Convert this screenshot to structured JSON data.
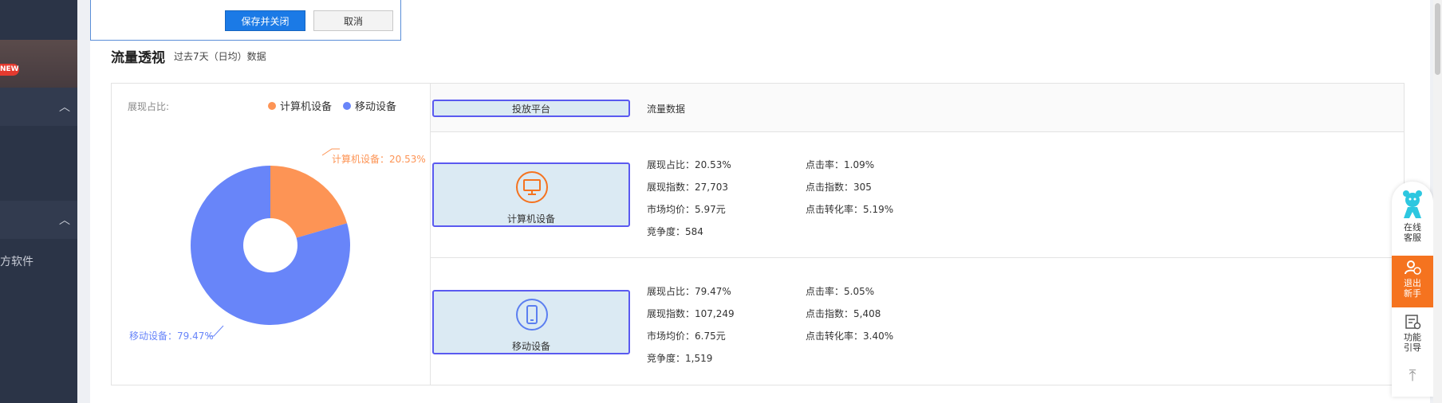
{
  "dialog": {
    "save_label": "保存并关闭",
    "cancel_label": "取消"
  },
  "sidebar": {
    "new_badge": "NEW",
    "item_label": "方软件"
  },
  "header": {
    "title": "流量透视",
    "subtitle": "过去7天（日均）数据"
  },
  "chart_data": {
    "type": "pie",
    "title": "展现占比:",
    "categories": [
      "计算机设备",
      "移动设备"
    ],
    "values": [
      20.53,
      79.47
    ],
    "colors": [
      "#fd9455",
      "#6885f9"
    ],
    "labels": [
      "计算机设备：20.53%",
      "移动设备：79.47%"
    ],
    "legend_position": "top-right",
    "donut": true
  },
  "table": {
    "col_platform": "投放平台",
    "col_data": "流量数据",
    "rows": [
      {
        "device": "计算机设备",
        "icon": "monitor-icon",
        "color": "#f5731f",
        "left": [
          "展现占比：20.53%",
          "展现指数：27,703",
          "市场均价：5.97元",
          "竞争度：584"
        ],
        "right": [
          "点击率：1.09%",
          "点击指数：305",
          "点击转化率：5.19%"
        ]
      },
      {
        "device": "移动设备",
        "icon": "phone-icon",
        "color": "#5b7ef0",
        "left": [
          "展现占比：79.47%",
          "展现指数：107,249",
          "市场均价：6.75元",
          "竞争度：1,519"
        ],
        "right": [
          "点击率：5.05%",
          "点击指数：5,408",
          "点击转化率：3.40%"
        ]
      }
    ]
  },
  "float_bar": {
    "service": [
      "在线",
      "客服"
    ],
    "exit": [
      "退出",
      "新手"
    ],
    "guide": [
      "功能",
      "引导"
    ]
  }
}
